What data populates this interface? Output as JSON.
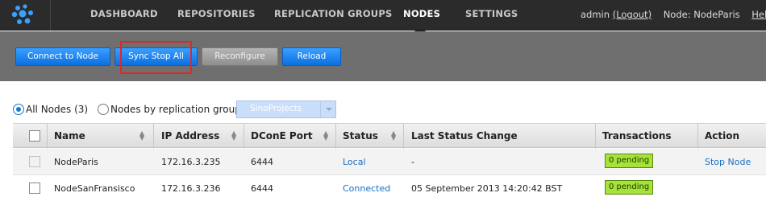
{
  "nav": {
    "items": [
      {
        "label": "DASHBOARD"
      },
      {
        "label": "REPOSITORIES"
      },
      {
        "label": "REPLICATION GROUPS"
      },
      {
        "label": "NODES"
      },
      {
        "label": "SETTINGS"
      }
    ],
    "user": "admin",
    "logout": "(Logout)",
    "node_label": "Node: NodeParis",
    "help": "Help"
  },
  "toolbar": {
    "connect": "Connect to Node",
    "sync_stop": "Sync Stop All",
    "reconfigure": "Reconfigure",
    "reload": "Reload"
  },
  "filter": {
    "all_nodes": "All Nodes (3)",
    "by_group": "Nodes by replication group",
    "group_value": "SinoProjects"
  },
  "table": {
    "headers": {
      "name": "Name",
      "ip": "IP Address",
      "port": "DConE Port",
      "status": "Status",
      "last_change": "Last Status Change",
      "transactions": "Transactions",
      "action": "Action"
    },
    "rows": [
      {
        "name": "NodeParis",
        "ip": "172.16.3.235",
        "port": "6444",
        "status": "Local",
        "last_change": "-",
        "transactions": "0 pending",
        "action": "Stop Node"
      },
      {
        "name": "NodeSanFransisco",
        "ip": "172.16.3.236",
        "port": "6444",
        "status": "Connected",
        "last_change": "05 September 2013 14:20:42 BST",
        "transactions": "0 pending",
        "action": ""
      }
    ]
  },
  "colors": {
    "nav_bg": "#2b2b2b",
    "toolbar_bg": "#6f6f6f",
    "button_blue": "#1a86f0",
    "pending_green": "#a6e23a",
    "link": "#1a6fc2",
    "highlight_red": "#e0262a"
  }
}
